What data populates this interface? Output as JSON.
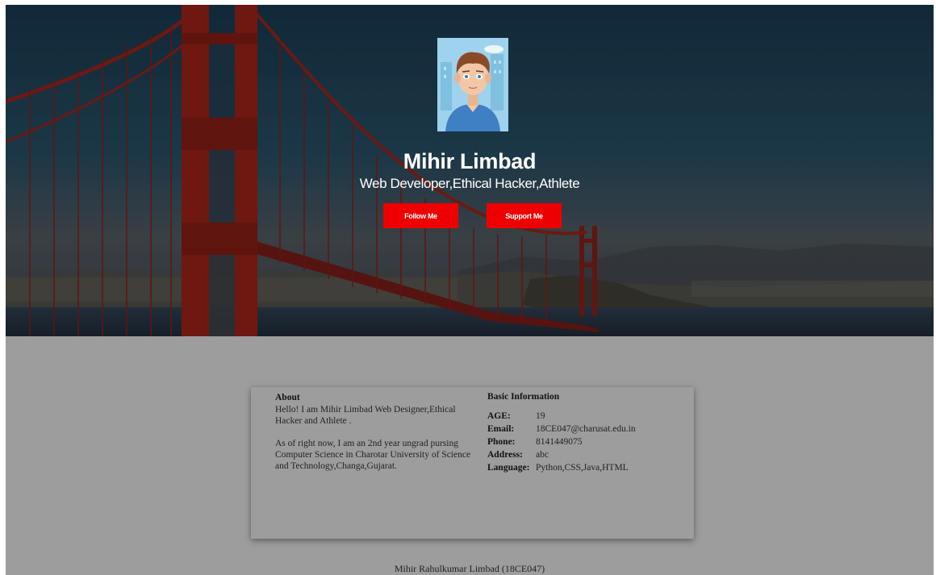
{
  "hero": {
    "name": "Mihir Limbad",
    "subtitle": "Web Developer,Ethical Hacker,Athlete",
    "follow_label": "Follow Me",
    "support_label": "Support Me",
    "button_color": "#ee0000"
  },
  "about": {
    "heading": "About",
    "paragraphs": [
      "Hello! I am Mihir Limbad Web Designer,Ethical Hacker and Athlete .",
      "As of right now, I am an 2nd year ungrad pursing Computer Science in Charotar University of Science and Technology,Changa,Gujarat."
    ]
  },
  "basic_info": {
    "heading": "Basic Information",
    "rows": [
      {
        "label": "AGE:",
        "value": "19"
      },
      {
        "label": "Email:",
        "value": "18CE047@charusat.edu.in"
      },
      {
        "label": "Phone:",
        "value": "8141449075"
      },
      {
        "label": "Address:",
        "value": "abc"
      },
      {
        "label": "Language:",
        "value": "Python,CSS,Java,HTML"
      }
    ]
  },
  "footer": {
    "text": "Mihir Rahulkumar Limbad (18CE047)"
  }
}
